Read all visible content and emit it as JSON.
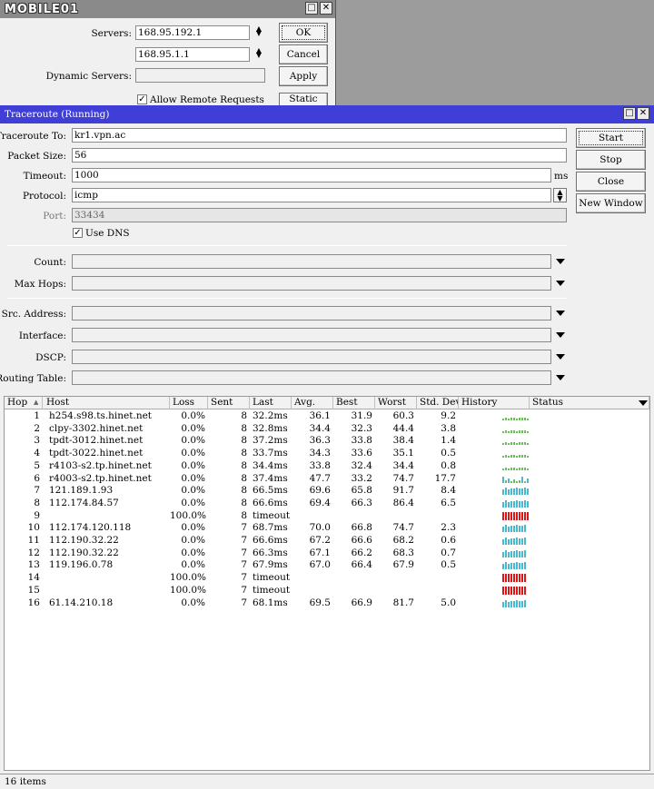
{
  "watermark": "MOBILE01",
  "dns_window": {
    "servers_label": "Servers:",
    "server1": "168.95.192.1",
    "server2": "168.95.1.1",
    "dynamic_label": "Dynamic Servers:",
    "dynamic_value": "",
    "allow_remote_label": "Allow Remote Requests",
    "ok_label": "OK",
    "cancel_label": "Cancel",
    "apply_label": "Apply",
    "static_label": "Static"
  },
  "traceroute": {
    "title": "Traceroute (Running)",
    "form": {
      "traceroute_to_label": "Traceroute To:",
      "traceroute_to": "kr1.vpn.ac",
      "packet_size_label": "Packet Size:",
      "packet_size": "56",
      "timeout_label": "Timeout:",
      "timeout": "1000",
      "timeout_unit": "ms",
      "protocol_label": "Protocol:",
      "protocol": "icmp",
      "port_label": "Port:",
      "port": "33434",
      "use_dns_label": "Use DNS",
      "count_label": "Count:",
      "max_hops_label": "Max Hops:",
      "src_address_label": "Src. Address:",
      "interface_label": "Interface:",
      "dscp_label": "DSCP:",
      "routing_table_label": "Routing Table:"
    },
    "buttons": {
      "start": "Start",
      "stop": "Stop",
      "close": "Close",
      "new_window": "New Window"
    },
    "columns": [
      "Hop",
      "Host",
      "Loss",
      "Sent",
      "Last",
      "Avg.",
      "Best",
      "Worst",
      "Std. Dev.",
      "History",
      "Status"
    ],
    "rows": [
      {
        "hop": "1",
        "host": "h254.s98.ts.hinet.net",
        "loss": "0.0%",
        "sent": "8",
        "last": "32.2ms",
        "avg": "36.1",
        "best": "31.9",
        "worst": "60.3",
        "std": "9.2",
        "hist": "green"
      },
      {
        "hop": "2",
        "host": "clpy-3302.hinet.net",
        "loss": "0.0%",
        "sent": "8",
        "last": "32.8ms",
        "avg": "34.4",
        "best": "32.3",
        "worst": "44.4",
        "std": "3.8",
        "hist": "green"
      },
      {
        "hop": "3",
        "host": "tpdt-3012.hinet.net",
        "loss": "0.0%",
        "sent": "8",
        "last": "37.2ms",
        "avg": "36.3",
        "best": "33.8",
        "worst": "38.4",
        "std": "1.4",
        "hist": "green"
      },
      {
        "hop": "4",
        "host": "tpdt-3022.hinet.net",
        "loss": "0.0%",
        "sent": "8",
        "last": "33.7ms",
        "avg": "34.3",
        "best": "33.6",
        "worst": "35.1",
        "std": "0.5",
        "hist": "green"
      },
      {
        "hop": "5",
        "host": "r4103-s2.tp.hinet.net",
        "loss": "0.0%",
        "sent": "8",
        "last": "34.4ms",
        "avg": "33.8",
        "best": "32.4",
        "worst": "34.4",
        "std": "0.8",
        "hist": "green"
      },
      {
        "hop": "6",
        "host": "r4003-s2.tp.hinet.net",
        "loss": "0.0%",
        "sent": "8",
        "last": "37.4ms",
        "avg": "47.7",
        "best": "33.2",
        "worst": "74.7",
        "std": "17.7",
        "hist": "mixed"
      },
      {
        "hop": "7",
        "host": "121.189.1.93",
        "loss": "0.0%",
        "sent": "8",
        "last": "66.5ms",
        "avg": "69.6",
        "best": "65.8",
        "worst": "91.7",
        "std": "8.4",
        "hist": "cyan"
      },
      {
        "hop": "8",
        "host": "112.174.84.57",
        "loss": "0.0%",
        "sent": "8",
        "last": "66.6ms",
        "avg": "69.4",
        "best": "66.3",
        "worst": "86.4",
        "std": "6.5",
        "hist": "cyan"
      },
      {
        "hop": "9",
        "host": "",
        "loss": "100.0%",
        "sent": "8",
        "last": "timeout",
        "avg": "",
        "best": "",
        "worst": "",
        "std": "",
        "hist": "red"
      },
      {
        "hop": "10",
        "host": "112.174.120.118",
        "loss": "0.0%",
        "sent": "7",
        "last": "68.7ms",
        "avg": "70.0",
        "best": "66.8",
        "worst": "74.7",
        "std": "2.3",
        "hist": "cyan"
      },
      {
        "hop": "11",
        "host": "112.190.32.22",
        "loss": "0.0%",
        "sent": "7",
        "last": "66.6ms",
        "avg": "67.2",
        "best": "66.6",
        "worst": "68.2",
        "std": "0.6",
        "hist": "cyan"
      },
      {
        "hop": "12",
        "host": "112.190.32.22",
        "loss": "0.0%",
        "sent": "7",
        "last": "66.3ms",
        "avg": "67.1",
        "best": "66.2",
        "worst": "68.3",
        "std": "0.7",
        "hist": "cyan"
      },
      {
        "hop": "13",
        "host": "119.196.0.78",
        "loss": "0.0%",
        "sent": "7",
        "last": "67.9ms",
        "avg": "67.0",
        "best": "66.4",
        "worst": "67.9",
        "std": "0.5",
        "hist": "cyan"
      },
      {
        "hop": "14",
        "host": "",
        "loss": "100.0%",
        "sent": "7",
        "last": "timeout",
        "avg": "",
        "best": "",
        "worst": "",
        "std": "",
        "hist": "red"
      },
      {
        "hop": "15",
        "host": "",
        "loss": "100.0%",
        "sent": "7",
        "last": "timeout",
        "avg": "",
        "best": "",
        "worst": "",
        "std": "",
        "hist": "red"
      },
      {
        "hop": "16",
        "host": "61.14.210.18",
        "loss": "0.0%",
        "sent": "7",
        "last": "68.1ms",
        "avg": "69.5",
        "best": "66.9",
        "worst": "81.7",
        "std": "5.0",
        "hist": "cyan"
      }
    ],
    "status_bar": "16 items"
  },
  "colors": {
    "titlebar": "#3f3fd8",
    "history_green": "#6abf5a",
    "history_cyan": "#4ab8cf",
    "history_red": "#d81818"
  }
}
